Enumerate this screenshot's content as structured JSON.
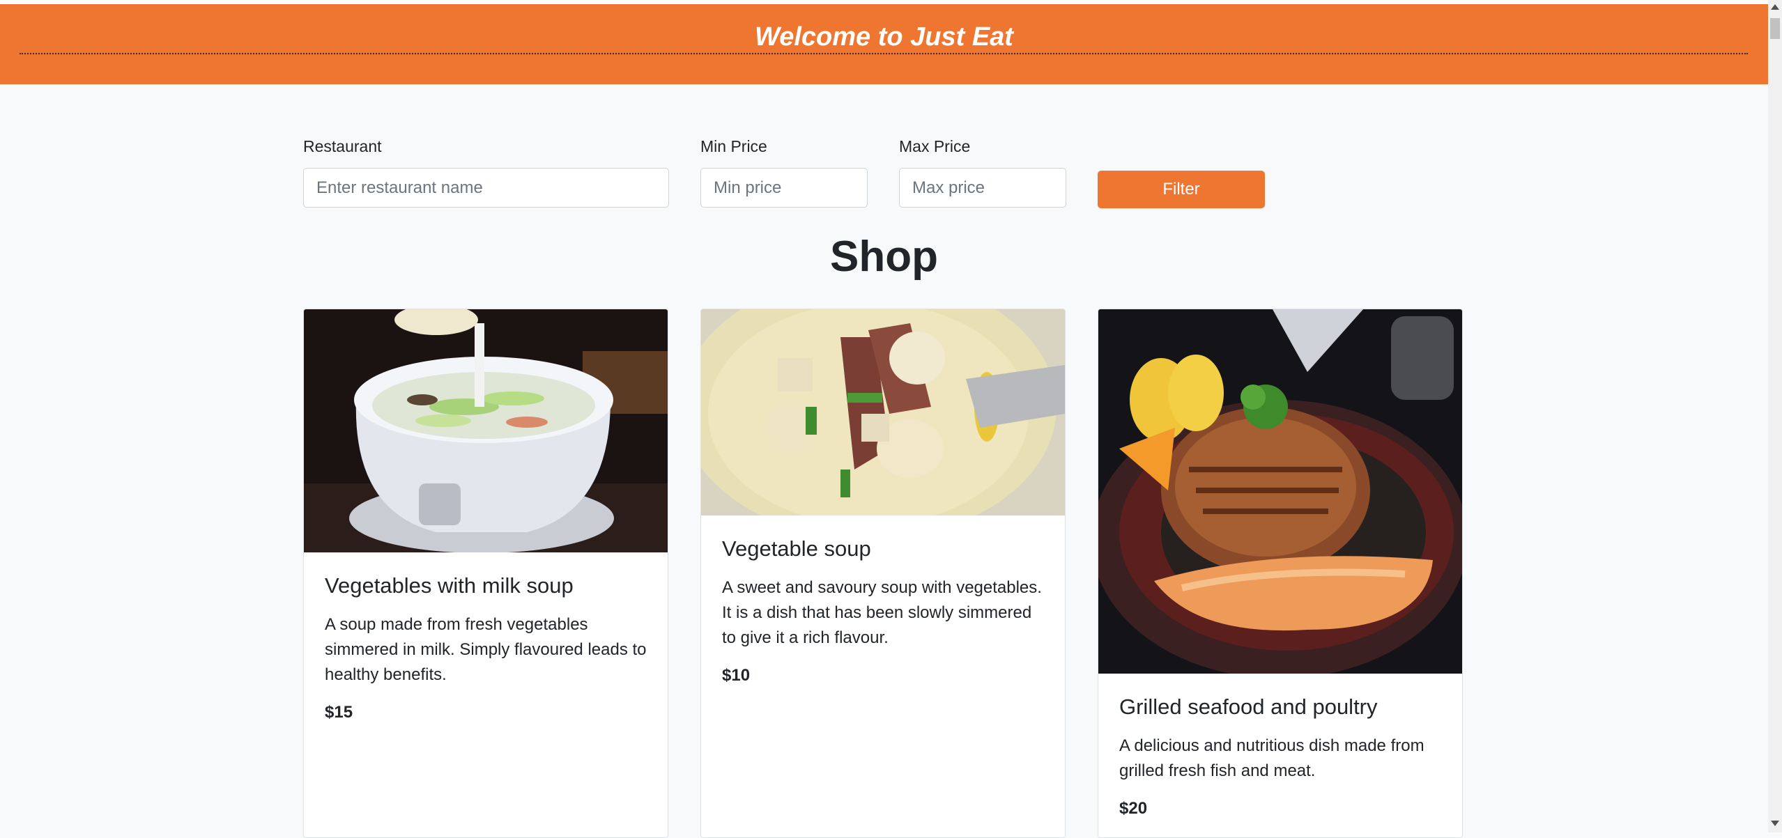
{
  "header": {
    "title": "Welcome to Just Eat"
  },
  "filters": {
    "restaurant_label": "Restaurant",
    "restaurant_placeholder": "Enter restaurant name",
    "min_label": "Min Price",
    "min_placeholder": "Min price",
    "max_label": "Max Price",
    "max_placeholder": "Max price",
    "button_label": "Filter"
  },
  "shop": {
    "title": "Shop",
    "items": [
      {
        "name": "Vegetables with milk soup",
        "description": "A soup made from fresh vegetables simmered in milk. Simply flavoured leads to healthy benefits.",
        "price": "$15",
        "image": "milk-soup-photo"
      },
      {
        "name": "Vegetable soup",
        "description": "A sweet and savoury soup with vegetables. It is a dish that has been slowly simmered to give it a rich flavour.",
        "price": "$10",
        "image": "vegetable-soup-photo"
      },
      {
        "name": "Grilled seafood and poultry",
        "description": "A delicious and nutritious dish made from grilled fresh fish and meat.",
        "price": "$20",
        "image": "grilled-platter-photo"
      }
    ]
  },
  "colors": {
    "brand": "#ee7631",
    "background": "#f8f9fa",
    "text": "#212529"
  }
}
